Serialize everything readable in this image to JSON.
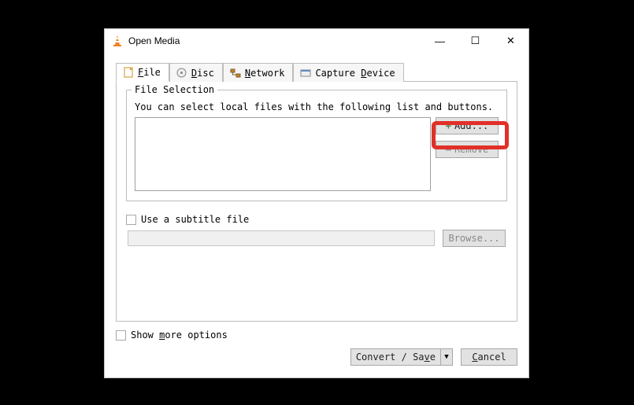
{
  "window": {
    "title": "Open Media"
  },
  "tabs": {
    "file_prefix": "",
    "file_ul": "F",
    "file_rest": "ile",
    "disc_prefix": "",
    "disc_ul": "D",
    "disc_rest": "isc",
    "network_prefix": "",
    "network_ul": "N",
    "network_rest": "etwork",
    "capture_prefix": "Capture ",
    "capture_ul": "D",
    "capture_rest": "evice"
  },
  "file_section": {
    "legend": "File Selection",
    "hint": "You can select local files with the following list and buttons.",
    "add_label": "Add...",
    "remove_label": "Remove"
  },
  "subtitle": {
    "checkbox_label": "Use a subtitle file",
    "browse_label": "Browse..."
  },
  "footer": {
    "more_prefix": "Show ",
    "more_ul": "m",
    "more_rest": "ore options",
    "convert_prefix": "Convert / Sa",
    "convert_ul": "v",
    "convert_rest": "e",
    "cancel_prefix": "",
    "cancel_ul": "C",
    "cancel_rest": "ancel",
    "dropdown_glyph": "▼"
  },
  "titlebar": {
    "minimize": "—",
    "maximize": "☐",
    "close": "✕"
  }
}
